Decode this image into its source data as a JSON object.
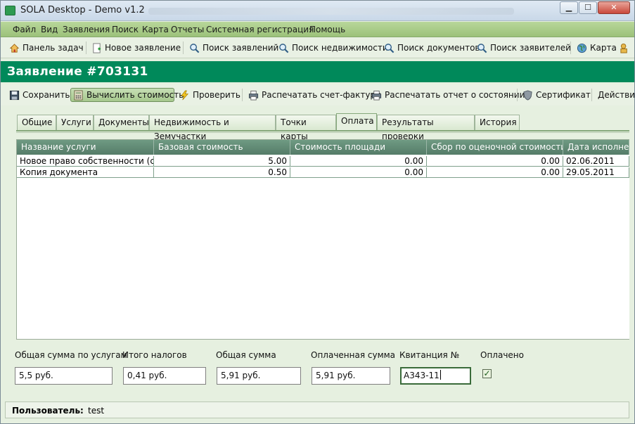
{
  "window": {
    "title": "SOLA Desktop - Demo v1.2",
    "min": "▁",
    "max": "☐",
    "close": "✕"
  },
  "menu": [
    "Файл",
    "Вид",
    "Заявления",
    "Поиск",
    "Карта",
    "Отчеты",
    "Системная регистрация",
    "Помощь"
  ],
  "toolbar1": {
    "taskbar": "Панель задач",
    "new_app": "Новое заявление",
    "search_apps": "Поиск заявлений",
    "search_property": "Поиск недвижимости",
    "search_docs": "Поиск документов",
    "search_applicants": "Поиск заявителей",
    "map": "Карта"
  },
  "header": {
    "title": "Заявление #703131"
  },
  "toolbar2": {
    "save": "Сохранить",
    "calculate": "Вычислить стоимость",
    "validate": "Проверить",
    "print_invoice": "Распечатать счет-фактуру",
    "print_status": "Распечатать отчет о состоянии",
    "certificate": "Сертификат",
    "actions": "Действи"
  },
  "tabs": [
    "Общие",
    "Услуги",
    "Документы",
    "Недвижимость и Земучастки",
    "Точки карты",
    "Оплата",
    "Результаты проверки",
    "История"
  ],
  "active_tab": "Оплата",
  "grid": {
    "columns": [
      "Название услуги",
      "Базовая стоимость",
      "Стоимость площади",
      "Сбор по оценочной стоимости",
      "Дата исполнени"
    ],
    "rows": [
      [
        "Новое право собственности (с...",
        "5.00",
        "0.00",
        "0.00",
        "02.06.2011"
      ],
      [
        "Копия документа",
        "0.50",
        "0.00",
        "0.00",
        "29.05.2011"
      ]
    ]
  },
  "payment": {
    "total_services_label": "Общая сумма по услугам",
    "total_services": "5,5 руб.",
    "tax_label": "Итого налогов",
    "tax": "0,41 руб.",
    "total_label": "Общая сумма",
    "total": "5,91 руб.",
    "paid_label": "Оплаченная сумма",
    "paid": "5,91 руб.",
    "receipt_label": "Квитанция №",
    "receipt": "А343-11",
    "paid_flag_label": "Оплачено",
    "paid_flag": true
  },
  "status": {
    "user_label": "Пользователь:",
    "user": "test"
  },
  "colors": {
    "accent": "#00895a",
    "menubar": "#a9cc88",
    "grid_header": "#628b75"
  }
}
